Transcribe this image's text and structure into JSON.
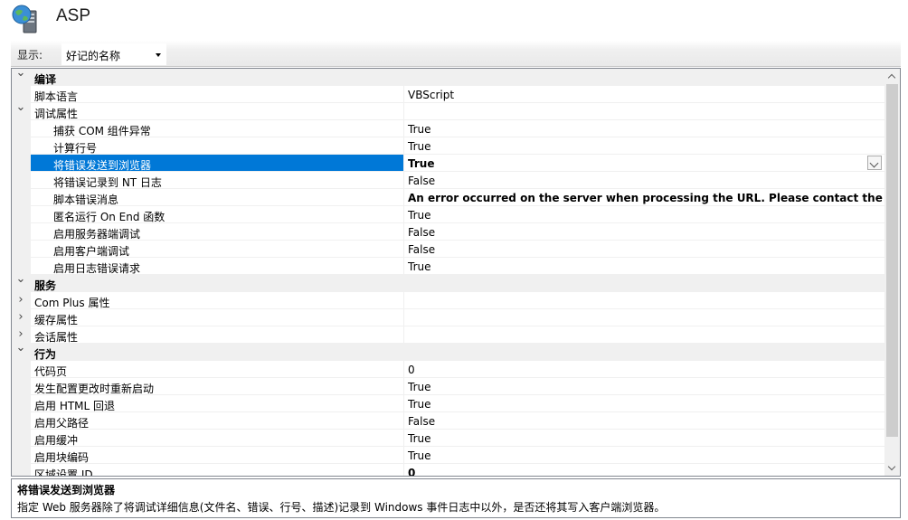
{
  "header": {
    "title": "ASP",
    "icon": "iis-globe-server-icon"
  },
  "toolbar": {
    "display_label": "显示:",
    "display_value": "好记的名称"
  },
  "grid": {
    "rows": [
      {
        "kind": "category",
        "label": "编译",
        "expanded": true
      },
      {
        "kind": "prop",
        "level": 1,
        "label": "脚本语言",
        "value": "VBScript"
      },
      {
        "kind": "group",
        "level": 1,
        "label": "调试属性",
        "expanded": true,
        "value": ""
      },
      {
        "kind": "prop",
        "level": 2,
        "label": "捕获 COM 组件异常",
        "value": "True"
      },
      {
        "kind": "prop",
        "level": 2,
        "label": "计算行号",
        "value": "True"
      },
      {
        "kind": "prop",
        "level": 2,
        "label": "将错误发送到浏览器",
        "value": "True",
        "selected": true
      },
      {
        "kind": "prop",
        "level": 2,
        "label": "将错误记录到 NT 日志",
        "value": "False"
      },
      {
        "kind": "prop",
        "level": 2,
        "label": "脚本错误消息",
        "value": "An error occurred on the server when processing the URL. Please contact the system a",
        "bold": true
      },
      {
        "kind": "prop",
        "level": 2,
        "label": "匿名运行 On End 函数",
        "value": "True"
      },
      {
        "kind": "prop",
        "level": 2,
        "label": "启用服务器端调试",
        "value": "False"
      },
      {
        "kind": "prop",
        "level": 2,
        "label": "启用客户端调试",
        "value": "False"
      },
      {
        "kind": "prop",
        "level": 2,
        "label": "启用日志错误请求",
        "value": "True"
      },
      {
        "kind": "category",
        "label": "服务",
        "expanded": true
      },
      {
        "kind": "group",
        "level": 1,
        "label": "Com Plus 属性",
        "expanded": false,
        "value": ""
      },
      {
        "kind": "group",
        "level": 1,
        "label": "缓存属性",
        "expanded": false,
        "value": ""
      },
      {
        "kind": "group",
        "level": 1,
        "label": "会话属性",
        "expanded": false,
        "value": ""
      },
      {
        "kind": "category",
        "label": "行为",
        "expanded": true
      },
      {
        "kind": "prop",
        "level": 1,
        "label": "代码页",
        "value": "0"
      },
      {
        "kind": "prop",
        "level": 1,
        "label": "发生配置更改时重新启动",
        "value": "True"
      },
      {
        "kind": "prop",
        "level": 1,
        "label": "启用 HTML 回退",
        "value": "True"
      },
      {
        "kind": "prop",
        "level": 1,
        "label": "启用父路径",
        "value": "False"
      },
      {
        "kind": "prop",
        "level": 1,
        "label": "启用缓冲",
        "value": "True"
      },
      {
        "kind": "prop",
        "level": 1,
        "label": "启用块编码",
        "value": "True"
      },
      {
        "kind": "prop",
        "level": 1,
        "label": "区域设置 ID",
        "value": "0",
        "bold": true
      }
    ]
  },
  "description": {
    "title": "将错误发送到浏览器",
    "text": "指定 Web 服务器除了将调试详细信息(文件名、错误、行号、描述)记录到 Windows 事件日志中以外，是否还将其写入客户端浏览器。"
  },
  "colors": {
    "selection": "#0078d7",
    "category_bg": "#f0f0f0"
  }
}
